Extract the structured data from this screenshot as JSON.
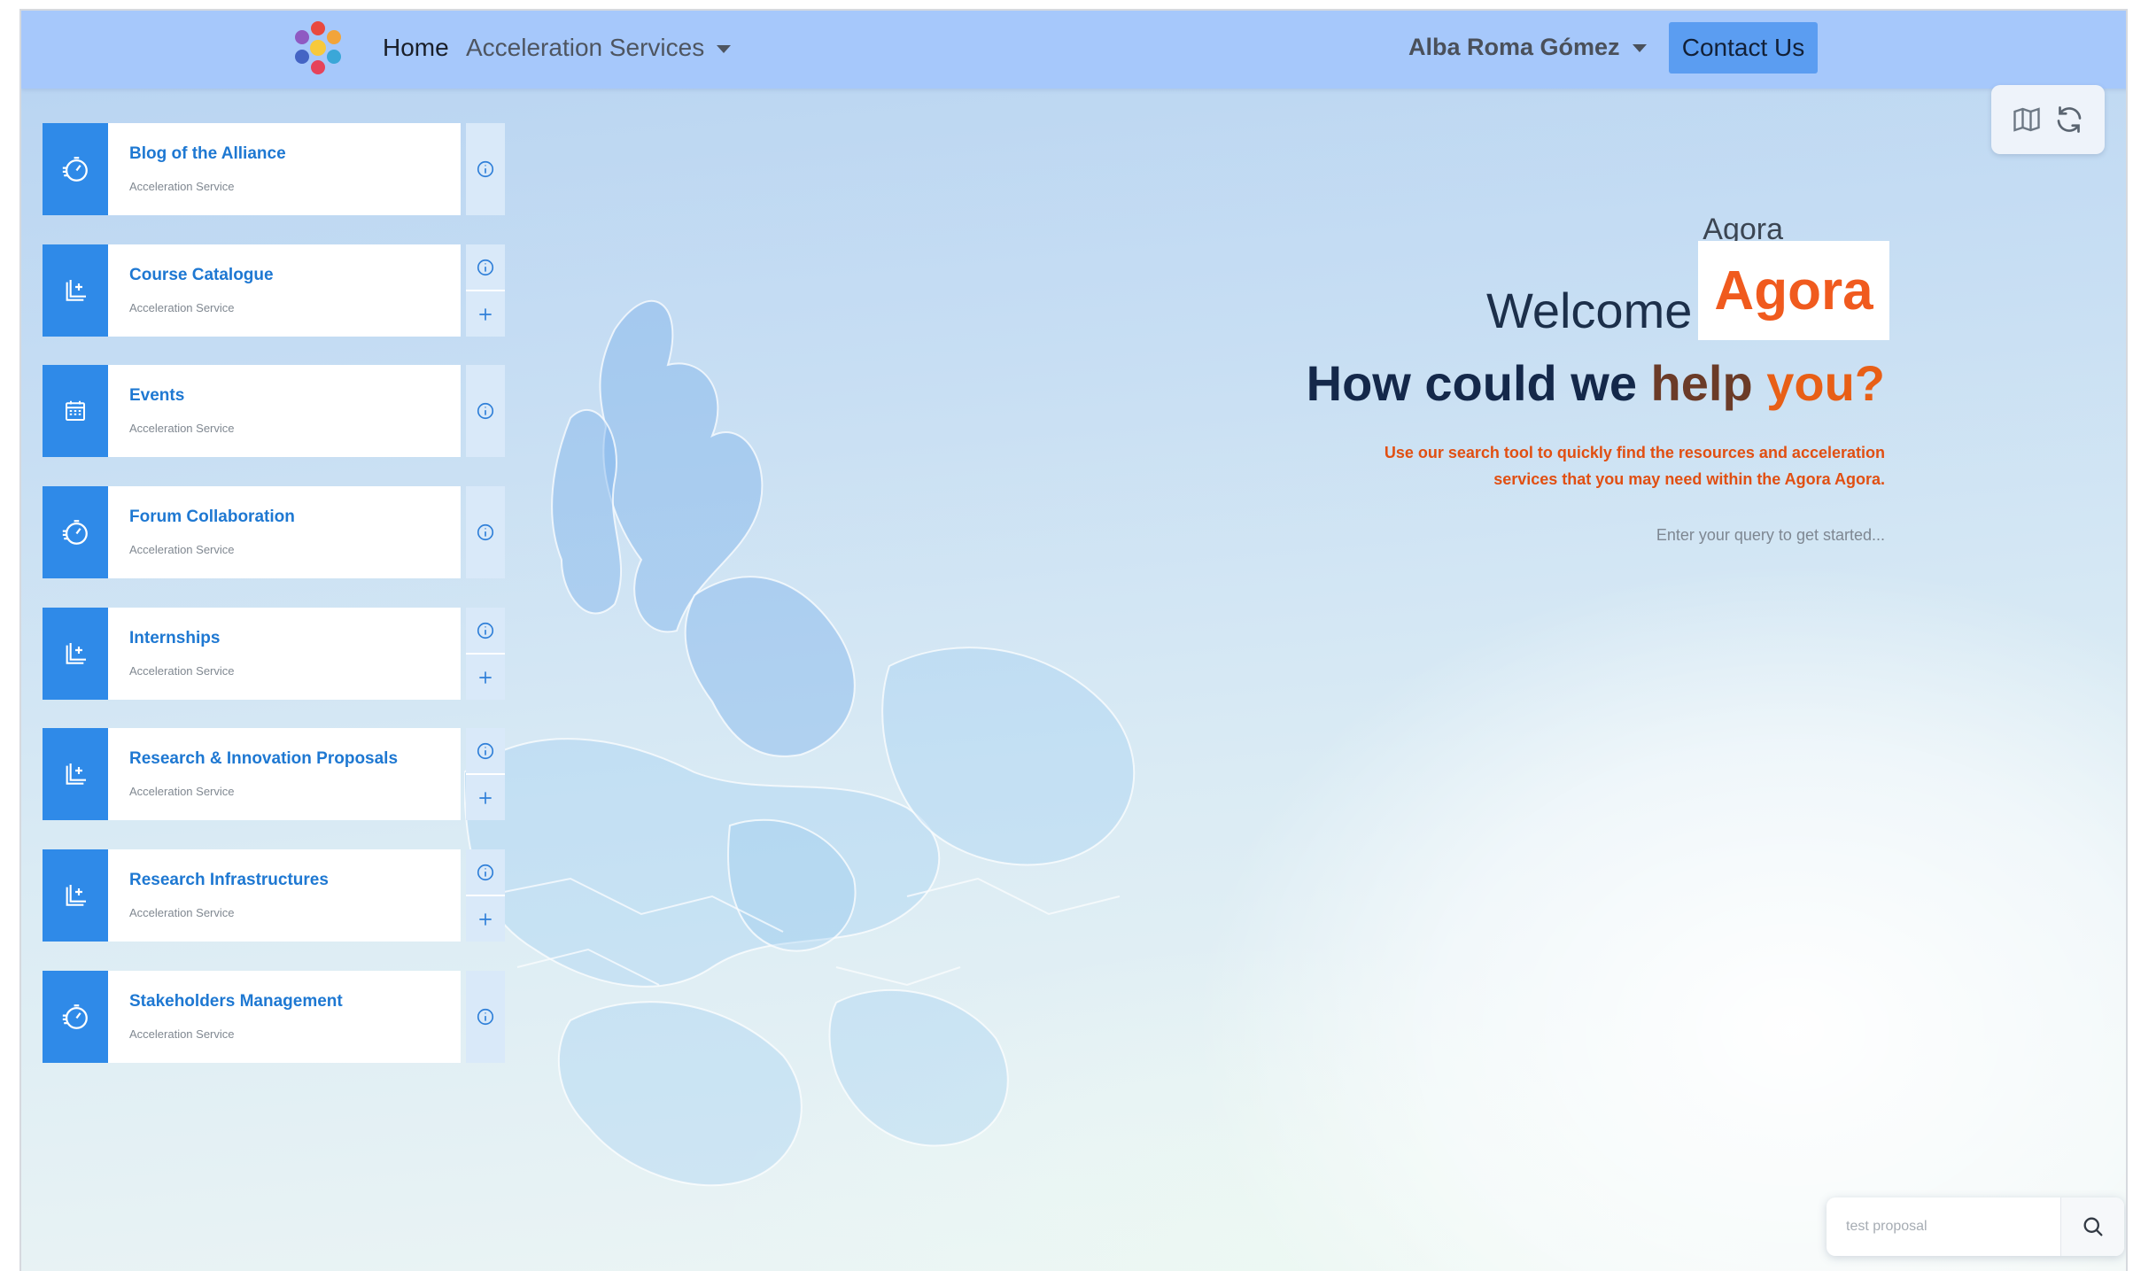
{
  "navbar": {
    "home_label": "Home",
    "services_label": "Acceleration Services",
    "user_name": "Alba Roma Gómez",
    "contact_label": "Contact Us"
  },
  "toolbox": {
    "icons": [
      "map-icon",
      "refresh-icon"
    ]
  },
  "services": [
    {
      "title": "Blog of the Alliance",
      "subtitle": "Acceleration Service",
      "icon": "speedometer-icon",
      "actions": [
        "info"
      ]
    },
    {
      "title": "Course Catalogue",
      "subtitle": "Acceleration Service",
      "icon": "add-document-icon",
      "actions": [
        "info",
        "add"
      ]
    },
    {
      "title": "Events",
      "subtitle": "Acceleration Service",
      "icon": "calendar-icon",
      "actions": [
        "info"
      ]
    },
    {
      "title": "Forum Collaboration",
      "subtitle": "Acceleration Service",
      "icon": "speedometer-icon",
      "actions": [
        "info"
      ]
    },
    {
      "title": "Internships",
      "subtitle": "Acceleration Service",
      "icon": "add-document-icon",
      "actions": [
        "info",
        "add"
      ]
    },
    {
      "title": "Research & Innovation Proposals",
      "subtitle": "Acceleration Service",
      "icon": "add-document-icon",
      "actions": [
        "info",
        "add"
      ]
    },
    {
      "title": "Research Infrastructures",
      "subtitle": "Acceleration Service",
      "icon": "add-document-icon",
      "actions": [
        "info",
        "add"
      ]
    },
    {
      "title": "Stakeholders Management",
      "subtitle": "Acceleration Service",
      "icon": "speedometer-icon",
      "actions": [
        "info"
      ]
    }
  ],
  "hero": {
    "agora_label": "Agora",
    "welcome": "Welcome",
    "logo_text": "Agora",
    "question_part1": "How could we",
    "question_part2": "help",
    "question_part3": "you?",
    "description": "Use our search tool to quickly find the resources and acceleration services that you may need within the Agora Agora.",
    "hint": "Enter your query to get started..."
  },
  "search": {
    "placeholder": "test proposal",
    "value": ""
  },
  "colors": {
    "navbar_bg": "#a6c8fb",
    "contact_bg": "#5b9df1",
    "card_accent": "#2f8ae8",
    "card_title": "#1e78d2",
    "brand_orange": "#f05a1e",
    "heading_navy": "#14284a"
  }
}
